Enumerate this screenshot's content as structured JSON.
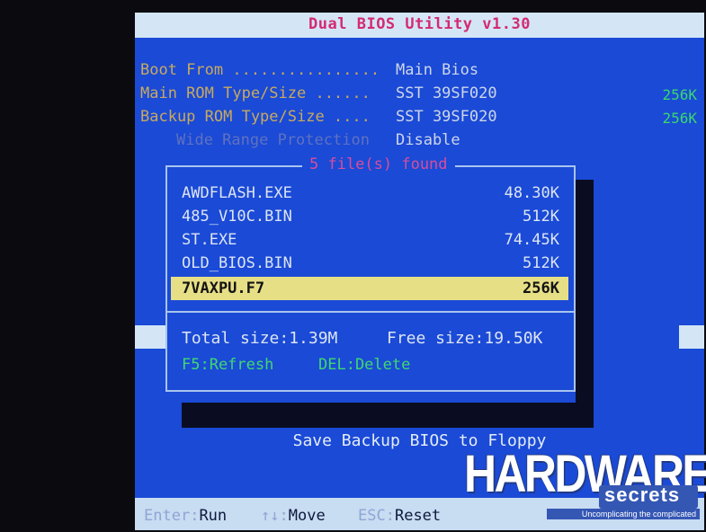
{
  "title": "Dual BIOS Utility v1.30",
  "info": {
    "boot_from_label": "Boot From ................",
    "boot_from_value": "Main Bios",
    "main_rom_label": "Main ROM Type/Size ......",
    "main_rom_value": "SST 39SF020",
    "main_rom_size": "256K",
    "backup_rom_label": "Backup ROM Type/Size ....",
    "backup_rom_value": "SST 39SF020",
    "backup_rom_size": "256K",
    "wide_range_label": "Wide Range Protection",
    "wide_range_value": "Disable"
  },
  "dialog": {
    "title": "5 file(s) found",
    "files": [
      {
        "name": "AWDFLASH.EXE",
        "size": "48.30K"
      },
      {
        "name": "485_V10C.BIN",
        "size": "512K"
      },
      {
        "name": "ST.EXE",
        "size": "74.45K"
      },
      {
        "name": "OLD_BIOS.BIN",
        "size": "512K"
      },
      {
        "name": "7VAXPU.F7",
        "size": "256K"
      }
    ],
    "total_size": "Total size:1.39M",
    "free_size": "Free size:19.50K",
    "refresh_key": "F5:Refresh",
    "delete_key": "DEL:Delete"
  },
  "status": "Save Backup BIOS to Floppy",
  "footer": {
    "enter_key": "Enter",
    "enter_action": "Run",
    "move_key": "↑↓",
    "move_action": "Move",
    "esc_key": "ESC",
    "esc_action": "Reset"
  },
  "watermark": {
    "brand": "HARDWARE",
    "brand_sub": "secrets",
    "tagline": "Uncomplicating the complicated"
  },
  "colors": {
    "screen_blue": "#1a4ad6",
    "title_pink": "#d42a72",
    "label_gold": "#c9a95f",
    "size_green": "#38d86e",
    "highlight_yellow": "#e7df86"
  }
}
